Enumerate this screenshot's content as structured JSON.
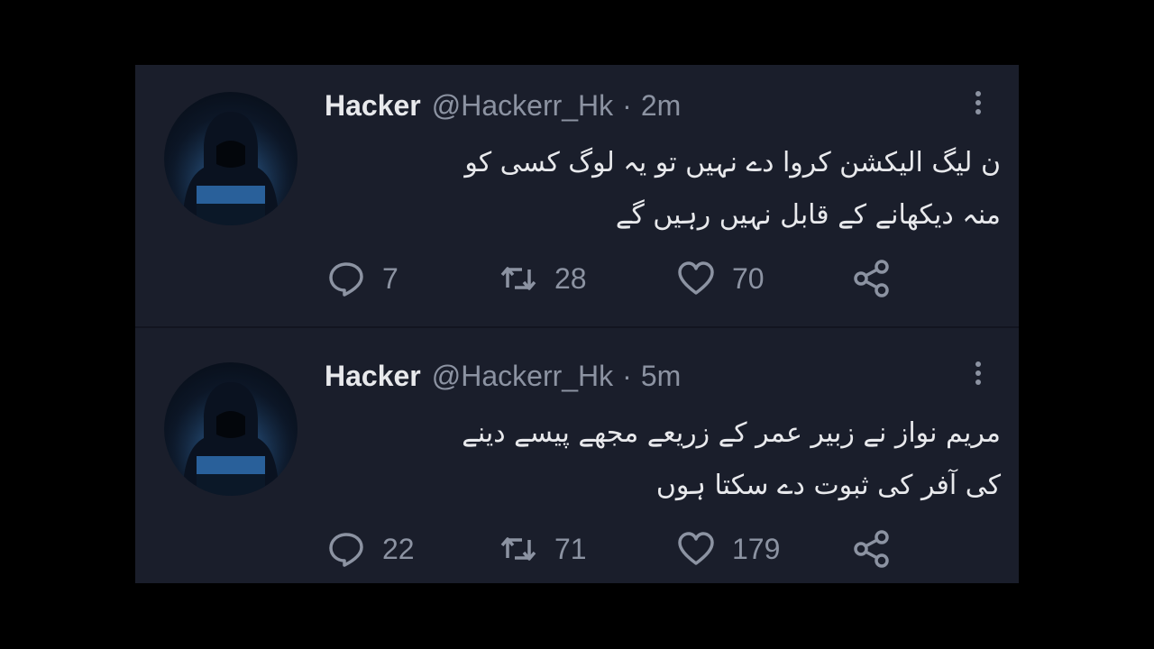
{
  "tweets": [
    {
      "name": "Hacker",
      "handle": "@Hackerr_Hk",
      "separator": "·",
      "time": "2m",
      "text_lines": [
        "ن لیگ الیکشن کروا دے نہیں تو یہ لوگ کسی کو",
        "منہ دیکھانے کے قابل نہیں رہیں گے"
      ],
      "replies": "7",
      "retweets": "28",
      "likes": "70"
    },
    {
      "name": "Hacker",
      "handle": "@Hackerr_Hk",
      "separator": "·",
      "time": "5m",
      "text_lines": [
        "مریم نواز نے زبیر عمر کے زریعے مجھے پیسے دینے",
        "کی آفر کی ثبوت دے سکتا ہوں"
      ],
      "replies": "22",
      "retweets": "71",
      "likes": "179"
    }
  ],
  "icons": {
    "more": "more-vertical-icon",
    "reply": "reply-icon",
    "retweet": "retweet-icon",
    "like": "heart-icon",
    "share": "share-icon"
  },
  "colors": {
    "background": "#000000",
    "panel": "#1a1e2b",
    "text": "#e8e9ec",
    "muted": "#8c93a2"
  }
}
